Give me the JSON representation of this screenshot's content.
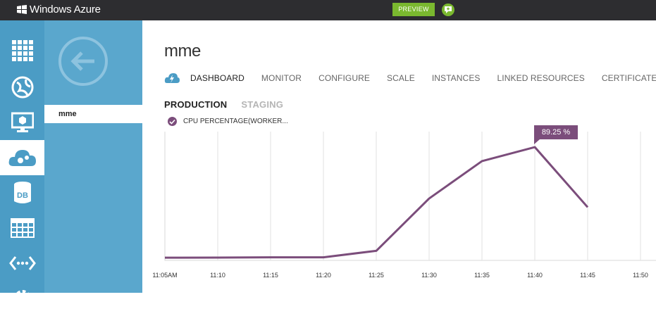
{
  "app": {
    "brand": "Windows Azure",
    "preview_label": "PREVIEW"
  },
  "left_nav": {
    "items": [
      "all-items",
      "web-sites",
      "virtual-machines",
      "cloud-services",
      "sql-databases",
      "storage",
      "networks",
      "settings"
    ]
  },
  "second_panel": {
    "items": [
      {
        "label": "mme"
      }
    ]
  },
  "page": {
    "title": "mme",
    "tabs": [
      "DASHBOARD",
      "MONITOR",
      "CONFIGURE",
      "SCALE",
      "INSTANCES",
      "LINKED RESOURCES",
      "CERTIFICATES"
    ],
    "subtabs": [
      "PRODUCTION",
      "STAGING"
    ],
    "metric_label": "CPU PERCENTAGE(WORKER..."
  },
  "colors": {
    "series": "#7b4d7b",
    "nav": "#4b9cc5",
    "panel": "#5aa7cd",
    "preview": "#7ab82f",
    "topbar": "#2d2d30"
  },
  "chart_data": {
    "type": "line",
    "x": [
      "11:05AM",
      "11:10",
      "11:15",
      "11:20",
      "11:25",
      "11:30",
      "11:35",
      "11:40",
      "11:45",
      "11:50"
    ],
    "series": [
      {
        "name": "CPU PERCENTAGE(WORKER...",
        "values": [
          0.5,
          0.6,
          0.8,
          0.8,
          6,
          48,
          78,
          89.25,
          41
        ]
      }
    ],
    "ylim": [
      0,
      100
    ],
    "grid": true,
    "tooltip": {
      "x": "11:40",
      "label": "89.25 %"
    }
  }
}
